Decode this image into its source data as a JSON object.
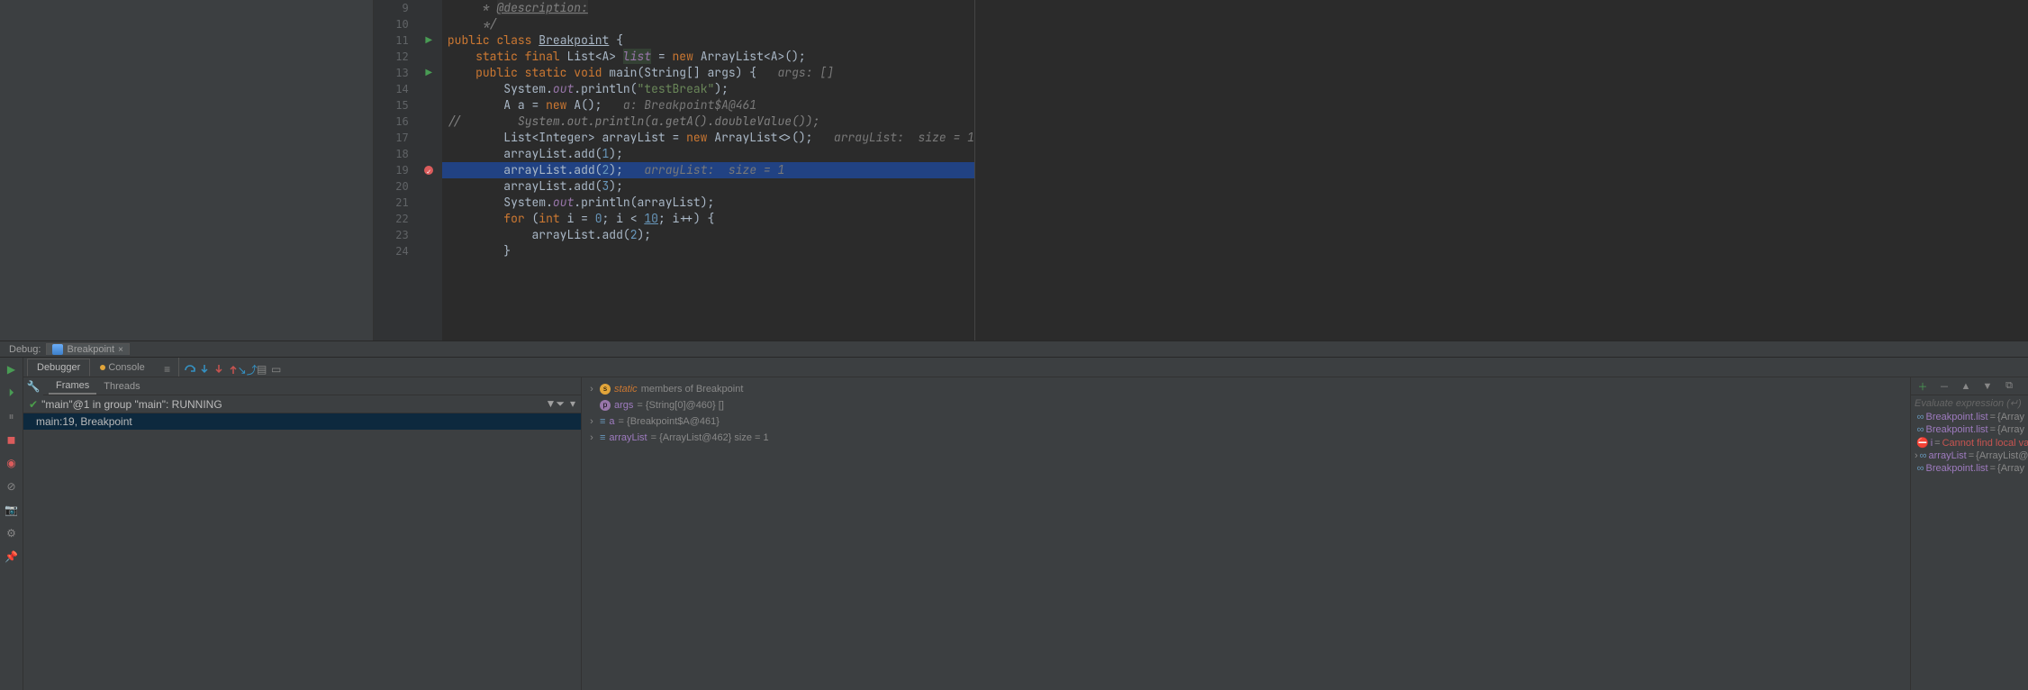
{
  "editor": {
    "lines": [
      {
        "n": 9,
        "gutter": "",
        "html": "     <span class='com'>* </span><span class='tag'>@description:</span>"
      },
      {
        "n": 10,
        "gutter": "",
        "html": "     <span class='com'>*/</span>"
      },
      {
        "n": 11,
        "gutter": "run",
        "html": "<span class='kw'>public class</span> <span class='id-u'>Breakpoint</span> {"
      },
      {
        "n": 12,
        "gutter": "",
        "html": "    <span class='kw'>static final</span> List&lt;A&gt; <span class='static-f' style='background:#344134'>list</span> = <span class='kw'>new</span> ArrayList&lt;<span>A</span>&gt;();"
      },
      {
        "n": 13,
        "gutter": "run",
        "html": "    <span class='kw'>public static void</span> main(String[] args) {   <span class='inlay'>args: []</span>"
      },
      {
        "n": 14,
        "gutter": "",
        "html": "        System.<span class='static-f'>out</span>.println(<span class='str'>\"testBreak\"</span>);"
      },
      {
        "n": 15,
        "gutter": "",
        "html": "        A a = <span class='kw'>new</span> A();   <span class='inlay'>a: Breakpoint$A@461</span>"
      },
      {
        "n": 16,
        "gutter": "",
        "html": "<span class='com'>//        System.out.println(a.getA().doubleValue());</span>"
      },
      {
        "n": 17,
        "gutter": "",
        "html": "        List&lt;Integer&gt; arrayList = <span class='kw'>new</span> ArrayList&lt;&gt;();   <span class='inlay'>arrayList:  size = 1</span>"
      },
      {
        "n": 18,
        "gutter": "",
        "html": "        arrayList.add(<span class='num'>1</span>);"
      },
      {
        "n": 19,
        "gutter": "bp",
        "hl": true,
        "html": "        arrayList.add(<span class='num'>2</span>);   <span class='inlay'>arrayList:  size = 1</span>"
      },
      {
        "n": 20,
        "gutter": "",
        "html": "        arrayList.add(<span class='num'>3</span>);"
      },
      {
        "n": 21,
        "gutter": "",
        "html": "        System.<span class='static-f'>out</span>.println(arrayList);"
      },
      {
        "n": 22,
        "gutter": "",
        "html": "        <span class='kw'>for</span> (<span class='kw'>int</span> i = <span class='num'>0</span>; i &lt; <span class='num id-u'>10</span>; i++) {"
      },
      {
        "n": 23,
        "gutter": "",
        "html": "            arrayList.add(<span class='num'>2</span>);"
      },
      {
        "n": 24,
        "gutter": "",
        "html": "        }"
      }
    ]
  },
  "debug": {
    "title_label": "Debug:",
    "tab_label": "Breakpoint",
    "top_tabs": {
      "debugger": "Debugger",
      "console": "Console"
    },
    "frames": {
      "tabs": {
        "frames": "Frames",
        "threads": "Threads"
      },
      "thread_label": "\"main\"@1 in group \"main\": RUNNING",
      "rows": [
        "main:19, Breakpoint"
      ]
    },
    "variables": {
      "static_label_a": "static",
      "static_label_b": "members of Breakpoint",
      "args_name": "args",
      "args_val": "= {String[0]@460} []",
      "a_name": "a",
      "a_val": "= {Breakpoint$A@461}",
      "al_name": "arrayList",
      "al_val": "= {ArrayList@462}  size = 1"
    },
    "watches": {
      "placeholder": "Evaluate expression  (↵)",
      "rows": [
        {
          "name": "Breakpoint.list",
          "eq": " = ",
          "val": "{Array",
          "cls": ""
        },
        {
          "name": "Breakpoint.list",
          "eq": " = ",
          "val": "{Array",
          "cls": ""
        },
        {
          "name": "i",
          "eq": " = ",
          "val": "Cannot find local va",
          "cls": "err"
        },
        {
          "name": "arrayList",
          "eq": " = ",
          "val": "{ArrayList@",
          "cls": ""
        },
        {
          "name": "Breakpoint.list",
          "eq": " = ",
          "val": "{Array",
          "cls": ""
        }
      ]
    }
  }
}
